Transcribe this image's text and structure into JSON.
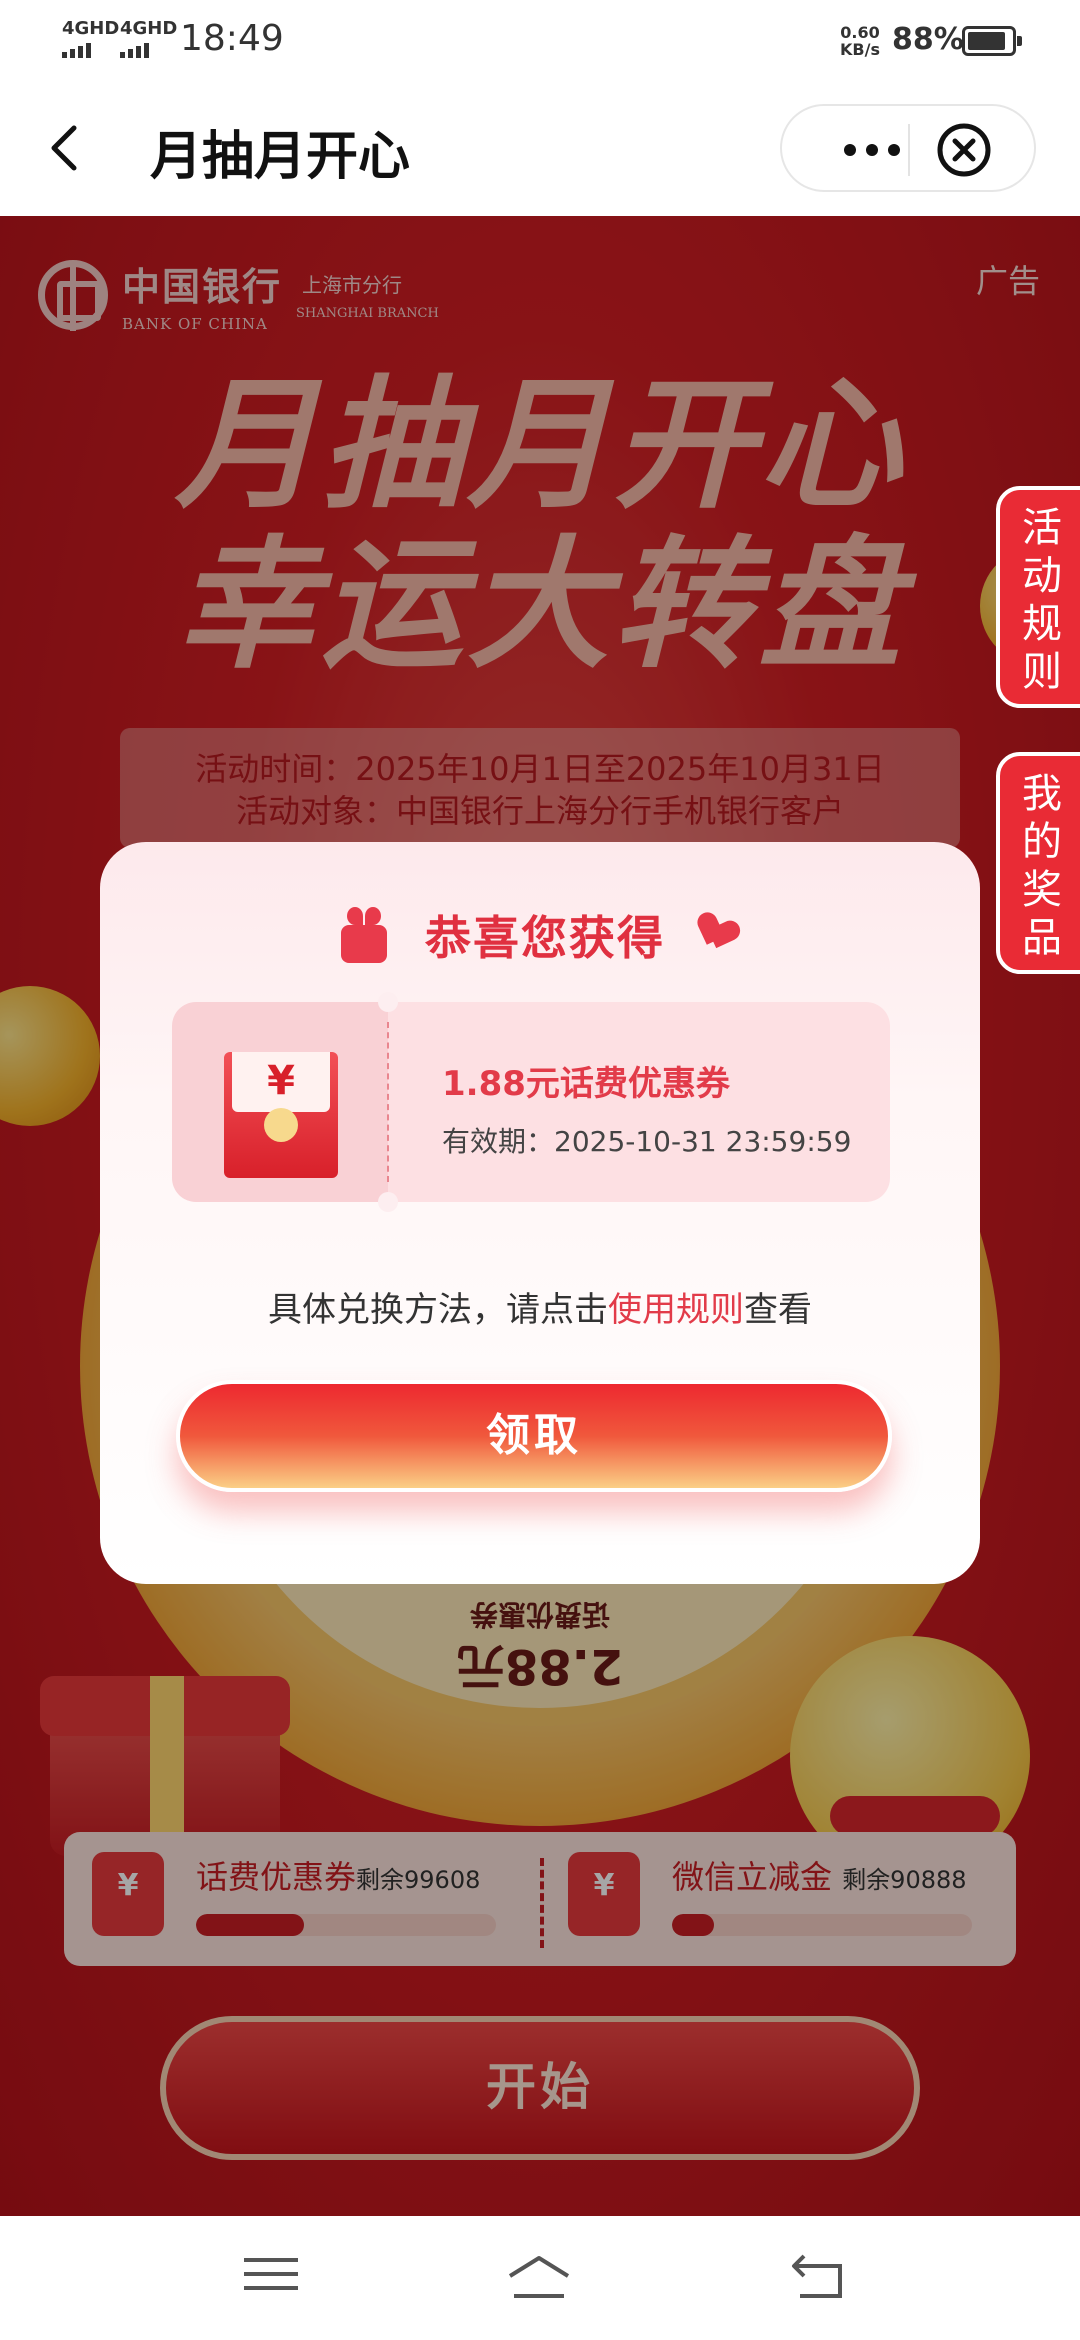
{
  "status_bar": {
    "signal_1": "4GHD",
    "signal_2": "4GHD",
    "time": "18:49",
    "speed_value": "0.60",
    "speed_unit": "KB/s",
    "battery": "88%",
    "battery_level": 0.88
  },
  "navbar": {
    "title": "月抽月开心",
    "back_icon": "chevron-left-icon",
    "more_icon": "more-dots-icon",
    "close_icon": "close-circle-icon"
  },
  "page": {
    "bank_name_cn": "中国银行",
    "bank_name_en": "BANK OF CHINA",
    "branch_cn": "上海市分行",
    "branch_en": "SHANGHAI BRANCH",
    "ad_label": "广告",
    "hero_line1": "月抽月开心",
    "hero_line2": "幸运大转盘",
    "activity_time": "活动时间：2025年10月1日至2025年10月31日",
    "activity_target": "活动对象：中国银行上海分行手机银行客户",
    "side_tab_rules": "活动规则",
    "side_tab_prizes": "我的奖品",
    "wheel_prize_amount": "2.88元",
    "wheel_prize_label": "话费优惠券",
    "progress": [
      {
        "title": "话费优惠券",
        "remain": "剩余99608",
        "fill": 0.36,
        "icon": "coupon-icon"
      },
      {
        "title": "微信立减金",
        "remain": "剩余90888",
        "fill": 0.14,
        "icon": "wechat-coupon-icon"
      }
    ],
    "start_button": "开始"
  },
  "modal": {
    "title": "恭喜您获得",
    "coupon_name": "1.88元话费优惠券",
    "coupon_valid": "有效期：2025-10-31 23:59:59",
    "coupon_symbol": "¥",
    "hint_prefix": "具体兑换方法，请点击",
    "hint_link": "使用规则",
    "hint_suffix": "查看",
    "claim_button": "领取"
  },
  "colors": {
    "brand_red": "#d21e23",
    "accent_pink": "#e23b49",
    "modal_bg": "#fff6f6"
  }
}
